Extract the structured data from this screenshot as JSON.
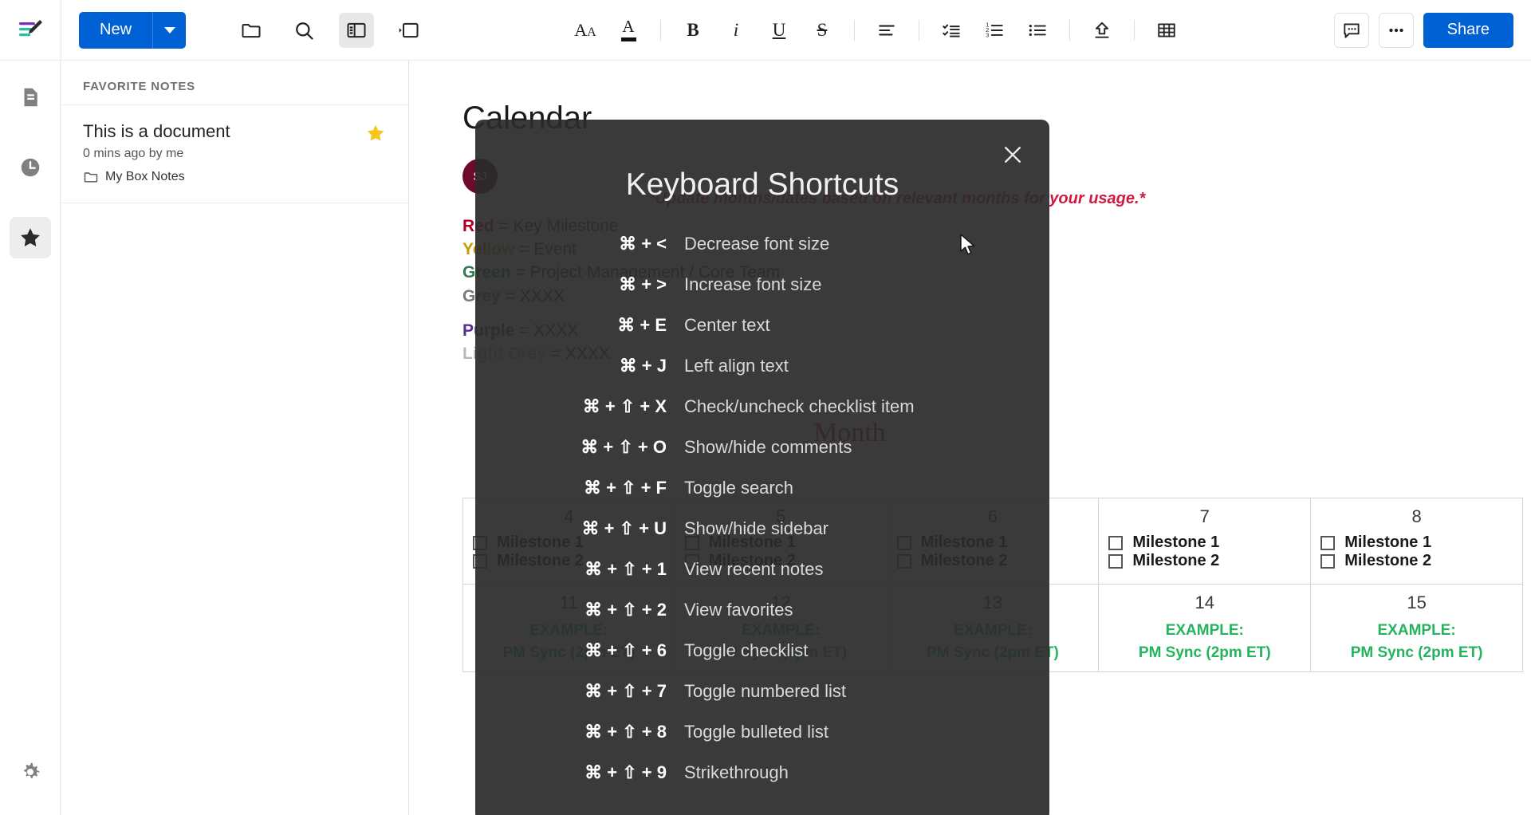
{
  "app": {
    "name": "Box Notes"
  },
  "toolbar": {
    "brand_icon": "box-notes-logo-icon",
    "new_label": "New",
    "new_caret_icon": "chevron-down-icon",
    "left_icons": [
      {
        "name": "folder-icon",
        "label": "All Notes"
      },
      {
        "name": "search-icon",
        "label": "Search"
      },
      {
        "name": "sidebar-layout-icon",
        "label": "Toggle sidebar",
        "active": true
      },
      {
        "name": "panel-collapse-icon",
        "label": "Collapse panel"
      }
    ],
    "format_icons": [
      {
        "name": "font-size-icon",
        "label": "AA"
      },
      {
        "name": "text-color-icon",
        "label": "A"
      },
      {
        "name": "bold-icon",
        "label": "B"
      },
      {
        "name": "italic-icon",
        "label": "i"
      },
      {
        "name": "underline-icon",
        "label": "U"
      },
      {
        "name": "strikethrough-icon",
        "label": "S"
      },
      {
        "name": "align-left-icon",
        "label": "Align"
      },
      {
        "name": "checklist-icon",
        "label": "Checklist"
      },
      {
        "name": "numbered-list-icon",
        "label": "Numbered list"
      },
      {
        "name": "bulleted-list-icon",
        "label": "Bulleted list"
      },
      {
        "name": "upload-icon",
        "label": "Upload"
      },
      {
        "name": "table-icon",
        "label": "Table"
      }
    ],
    "comment_icon": "comment-icon",
    "more_icon": "ellipsis-icon",
    "share_label": "Share"
  },
  "rail": {
    "items": [
      {
        "name": "sidebar-item-all-notes",
        "icon": "document-icon",
        "active": false
      },
      {
        "name": "sidebar-item-recent",
        "icon": "clock-icon",
        "active": false
      },
      {
        "name": "sidebar-item-favorites",
        "icon": "star-icon",
        "active": true
      }
    ],
    "settings": {
      "name": "sidebar-item-settings",
      "icon": "gear-icon"
    }
  },
  "sidebar": {
    "section_title": "FAVORITE NOTES",
    "notes": [
      {
        "title": "This is a document",
        "meta": "0 mins ago by me",
        "folder": "My Box Notes",
        "folder_icon": "folder-icon",
        "favorited": true,
        "star_icon": "star-filled-icon"
      }
    ]
  },
  "document": {
    "heading": "Calendar",
    "avatar_initials": "SJ",
    "red_note": "*Update months/dates based on relevant months for your usage.*",
    "legend": [
      {
        "color_name": "Red",
        "color_hex": "#b00020",
        "meaning": "Key Milestone"
      },
      {
        "color_name": "Yellow",
        "color_hex": "#c99a00",
        "meaning": "Event"
      },
      {
        "color_name": "Green",
        "color_hex": "#2e7d4f",
        "meaning": "Project Management / Core Team"
      },
      {
        "color_name": "Grey",
        "color_hex": "#7a7a7a",
        "meaning": "XXXX"
      },
      {
        "color_name": "Purple",
        "color_hex": "#5b2d8e",
        "meaning": "XXXX"
      },
      {
        "color_name": "Light Grey",
        "color_hex": "#b9b9b9",
        "meaning": "XXXX"
      }
    ],
    "month_title": "Month",
    "calendar": {
      "rows": [
        [
          {
            "day": "4",
            "checks": [
              "Milestone 1",
              "Milestone 2"
            ],
            "events": []
          },
          {
            "day": "5",
            "checks": [
              "Milestone 1",
              "Milestone 2"
            ],
            "events": []
          },
          {
            "day": "6",
            "checks": [
              "Milestone 1",
              "Milestone 2"
            ],
            "events": []
          },
          {
            "day": "7",
            "checks": [
              "Milestone 1",
              "Milestone 2"
            ],
            "events": []
          },
          {
            "day": "8",
            "checks": [
              "Milestone 1",
              "Milestone 2"
            ],
            "events": []
          }
        ],
        [
          {
            "day": "11",
            "checks": [],
            "events": [
              "EXAMPLE:",
              "PM Sync (2pm ET)"
            ]
          },
          {
            "day": "12",
            "checks": [],
            "events": [
              "EXAMPLE:",
              "PM Sync (2pm ET)"
            ]
          },
          {
            "day": "13",
            "checks": [],
            "events": [
              "EXAMPLE:",
              "PM Sync (2pm ET)"
            ]
          },
          {
            "day": "14",
            "checks": [],
            "events": [
              "EXAMPLE:",
              "PM Sync (2pm ET)"
            ]
          },
          {
            "day": "15",
            "checks": [],
            "events": [
              "EXAMPLE:",
              "PM Sync (2pm ET)"
            ]
          }
        ]
      ]
    }
  },
  "modal": {
    "title": "Keyboard Shortcuts",
    "close_icon": "close-icon",
    "shortcuts": [
      {
        "keys": "⌘ + <",
        "desc": "Decrease font size"
      },
      {
        "keys": "⌘ + >",
        "desc": "Increase font size"
      },
      {
        "keys": "⌘ + E",
        "desc": "Center text"
      },
      {
        "keys": "⌘ + J",
        "desc": "Left align text"
      },
      {
        "keys": "⌘ + ⇧ + X",
        "desc": "Check/uncheck checklist item"
      },
      {
        "keys": "⌘ + ⇧ + O",
        "desc": "Show/hide comments"
      },
      {
        "keys": "⌘ + ⇧ + F",
        "desc": "Toggle search"
      },
      {
        "keys": "⌘ + ⇧ + U",
        "desc": "Show/hide sidebar"
      },
      {
        "keys": "⌘ + ⇧ + 1",
        "desc": "View recent notes"
      },
      {
        "keys": "⌘ + ⇧ + 2",
        "desc": "View favorites"
      },
      {
        "keys": "⌘ + ⇧ + 6",
        "desc": "Toggle checklist"
      },
      {
        "keys": "⌘ + ⇧ + 7",
        "desc": "Toggle numbered list"
      },
      {
        "keys": "⌘ + ⇧ + 8",
        "desc": "Toggle bulleted list"
      },
      {
        "keys": "⌘ + ⇧ + 9",
        "desc": "Strikethrough"
      }
    ]
  },
  "colors": {
    "accent": "#0061d5",
    "favorite_star": "#f5c518",
    "modal_bg": "#2b2b2b",
    "event_green": "#25b35e",
    "note_red": "#d0193f"
  }
}
